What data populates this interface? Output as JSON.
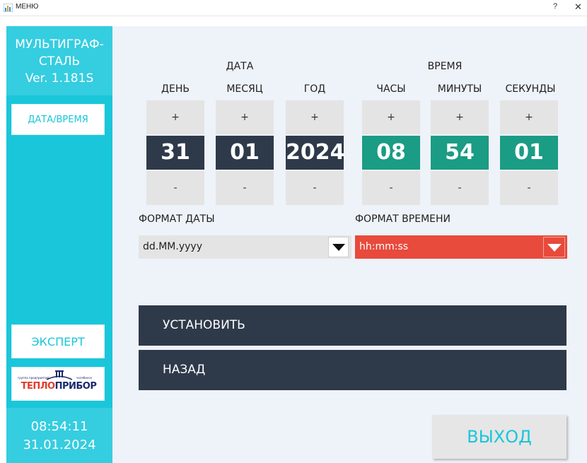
{
  "window": {
    "title": "МЕНЮ",
    "help": "?",
    "close": "✕"
  },
  "sidebar": {
    "app_name_line1": "МУЛЬТИГРАФ-",
    "app_name_line2": "СТАЛЬ",
    "version": "Ver. 1.181S",
    "datetime_button": "ДАТА/ВРЕМЯ",
    "expert_button": "ЭКСПЕРТ",
    "logo": {
      "small_left": "группа предприятий",
      "small_right": "челябинск",
      "part1": "ТЕПЛО",
      "part2": "ПРИБОР"
    },
    "clock_time": "08:54:11",
    "clock_date": "31.01.2024"
  },
  "date": {
    "title": "ДАТА",
    "columns": [
      {
        "label": "ДЕНЬ",
        "value": "31",
        "plus": "+",
        "minus": "-"
      },
      {
        "label": "МЕСЯЦ",
        "value": "01",
        "plus": "+",
        "minus": "-"
      },
      {
        "label": "ГОД",
        "value": "2024",
        "plus": "+",
        "minus": "-"
      }
    ]
  },
  "time": {
    "title": "ВРЕМЯ",
    "columns": [
      {
        "label": "ЧАСЫ",
        "value": "08",
        "plus": "+",
        "minus": "-"
      },
      {
        "label": "МИНУТЫ",
        "value": "54",
        "plus": "+",
        "minus": "-"
      },
      {
        "label": "СЕКУНДЫ",
        "value": "01",
        "plus": "+",
        "minus": "-"
      }
    ]
  },
  "format": {
    "date_label": "ФОРМАТ ДАТЫ",
    "date_value": "dd.MM.yyyy",
    "time_label": "ФОРМАТ ВРЕМЕНИ",
    "time_value": "hh:mm:ss"
  },
  "actions": {
    "set": "УСТАНОВИТЬ",
    "back": "НАЗАД",
    "exit": "ВЫХОД"
  },
  "colors": {
    "sidebar": "#1ac6da",
    "dark_value": "#2e3a4a",
    "green_value": "#1b9c84",
    "dropdown_active": "#e84a3c"
  }
}
